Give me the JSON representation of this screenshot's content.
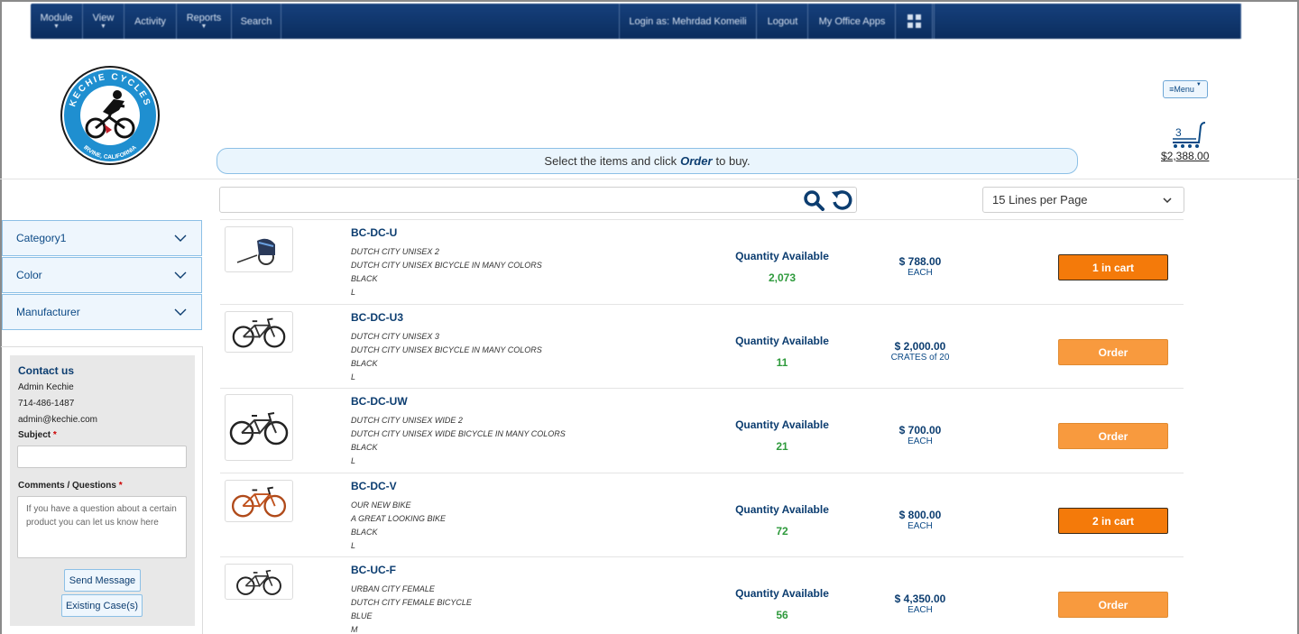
{
  "nav": {
    "items": [
      {
        "label": "Module",
        "caret": true
      },
      {
        "label": "View",
        "caret": true
      },
      {
        "label": "Activity",
        "caret": false
      },
      {
        "label": "Reports",
        "caret": true
      },
      {
        "label": "Search",
        "caret": false
      }
    ],
    "login": "Login as: Mehrdad Komeili",
    "logout": "Logout",
    "office_apps": "My Office Apps",
    "color": "#0b2d5e"
  },
  "header": {
    "logo": {
      "top_text": "KECHIE CYCLES",
      "bottom_text": "IRVINE, CALIFORNIA"
    },
    "menu_label": "≡Menu",
    "cart": {
      "count": "3",
      "total": "$2,388.00"
    },
    "banner_pre": "Select the items and click",
    "banner_em": "Order",
    "banner_post": "to buy."
  },
  "toolbar": {
    "search_value": "",
    "lines_per_page": "15 Lines per Page"
  },
  "filters": [
    {
      "label": "Category1"
    },
    {
      "label": "Color"
    },
    {
      "label": "Manufacturer"
    }
  ],
  "contact": {
    "title": "Contact us",
    "name": "Admin Kechie",
    "phone": "714-486-1487",
    "email": "admin@kechie.com",
    "subject_label": "Subject",
    "comments_label": "Comments / Questions",
    "required_mark": "*",
    "comments_placeholder": "If you have a question about a certain product you can let us know here",
    "send_label": "Send Message",
    "cases_label": "Existing Case(s)"
  },
  "products": [
    {
      "sku": "BC-DC-U",
      "desc": [
        "DUTCH CITY UNISEX 2",
        "DUTCH CITY UNISEX BICYCLE IN MANY COLORS",
        "BLACK",
        "L"
      ],
      "qty_label": "Quantity Available",
      "qty": "2,073",
      "price": "$ 788.00",
      "unit": "EACH",
      "button": "1 in cart",
      "in_cart": true,
      "image": "bike-trailer-icon"
    },
    {
      "sku": "BC-DC-U3",
      "desc": [
        "DUTCH CITY UNISEX 3",
        "DUTCH CITY UNISEX BICYCLE IN MANY COLORS",
        "BLACK",
        "L"
      ],
      "qty_label": "Quantity Available",
      "qty": "11",
      "price": "$ 2,000.00",
      "unit": "CRATES of 20",
      "button": "Order",
      "in_cart": false,
      "image": "bicycle-icon"
    },
    {
      "sku": "BC-DC-UW",
      "desc": [
        "DUTCH CITY UNISEX WIDE 2",
        "DUTCH CITY UNISEX WIDE BICYCLE IN MANY COLORS",
        "BLACK",
        "L"
      ],
      "qty_label": "Quantity Available",
      "qty": "21",
      "price": "$ 700.00",
      "unit": "EACH",
      "button": "Order",
      "in_cart": false,
      "image": "bicycle-icon"
    },
    {
      "sku": "BC-DC-V",
      "desc": [
        "OUR NEW BIKE",
        "A GREAT LOOKING BIKE",
        "BLACK",
        "L"
      ],
      "qty_label": "Quantity Available",
      "qty": "72",
      "price": "$ 800.00",
      "unit": "EACH",
      "button": "2 in cart",
      "in_cart": true,
      "image": "bicycle-icon"
    },
    {
      "sku": "BC-UC-F",
      "desc": [
        "URBAN CITY FEMALE",
        "DUTCH CITY FEMALE BICYCLE",
        "BLUE",
        "M"
      ],
      "qty_label": "Quantity Available",
      "qty": "56",
      "price": "$ 4,350.00",
      "unit": "EACH",
      "button": "Order",
      "in_cart": false,
      "image": "bicycle-icon"
    }
  ],
  "colors": {
    "accent": "#0c3d70",
    "in_cart": "#f47a0a",
    "order": "#f89a3e",
    "qty": "#2e9a3c"
  }
}
